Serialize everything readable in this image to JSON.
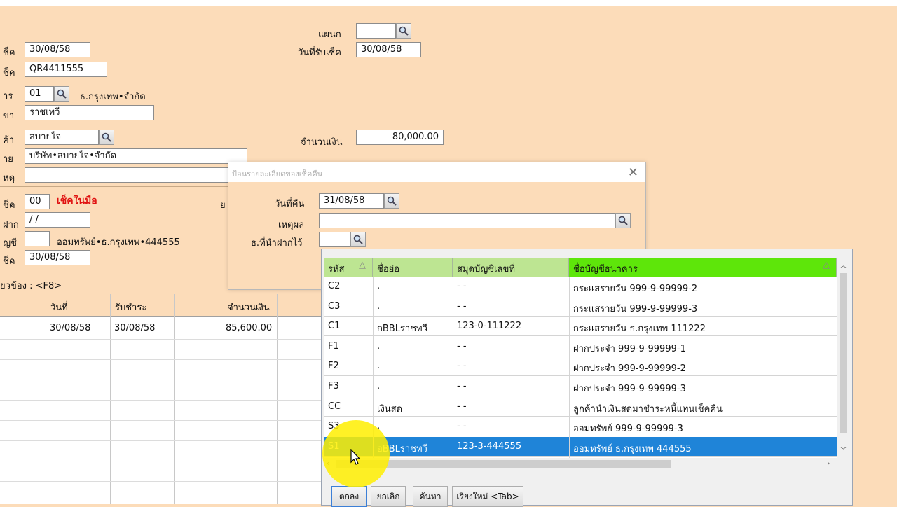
{
  "form": {
    "f_dept_label": "แผนก",
    "f_dept_value": "",
    "f_cheque_date_label": "ช็ค",
    "f_cheque_date_value": "30/08/58",
    "f_receive_date_label": "วันที่รับเช็ค",
    "f_receive_date_value": "30/08/58",
    "f_cheque_no_label": "ช็ค",
    "f_cheque_no_value": "QR4411555",
    "f_bank_label": "าร",
    "f_bank_code": "01",
    "f_bank_name": "ธ.กรุงเทพ•จำกัด",
    "f_branch_label": "ขา",
    "f_branch_value": "ราชเทวี",
    "f_customer_label": "ค้า",
    "f_customer_value": "สบายใจ",
    "f_amount_label": "จำนวนเงิน",
    "f_amount_value": "80,000.00",
    "f_payer_label": "าย",
    "f_payer_value": "บริษัท•สบายใจ•จำกัด",
    "f_note_label": "หตุ",
    "f_note_value": "",
    "f_status_label": "ช็ค",
    "f_status_code": "00",
    "f_status_text": "เช็คในมือ",
    "f_partial_label": "ย",
    "f_deposit_date_label": "ฝาก",
    "f_deposit_date_value": " / /",
    "f_account_label": "ญชี",
    "f_account_value": "",
    "f_account_name": "ออมทรัพย์•ธ.กรุงเทพ•444555",
    "f_clear_label": "ช็ค",
    "f_clear_value": "30/08/58",
    "f_related_label": "ยวข้อง :  <F8>"
  },
  "bg_table": {
    "headers": [
      "วันที่",
      "รับชำระ",
      "จำนวนเงิน"
    ],
    "rows": [
      [
        "30/08/58",
        "30/08/58",
        "85,600.00"
      ]
    ]
  },
  "dialog": {
    "title": "ป้อนรายละเอียดของเช็คคืน",
    "return_date_label": "วันที่คืน",
    "return_date_value": "31/08/58",
    "reason_label": "เหตุผล",
    "reason_value": "",
    "deposit_bank_label": "ธ.ที่นำฝากไว้",
    "deposit_bank_value": ""
  },
  "lookup": {
    "columns": [
      "รหัส",
      "ชื่อย่อ",
      "สมุดบัญชีเลขที่",
      "ชื่อบัญชีธนาคาร"
    ],
    "rows": [
      {
        "code": "C2",
        "short": ".",
        "book": "- -",
        "name": "กระแสรายวัน 999-9-99999-2"
      },
      {
        "code": "C3",
        "short": ".",
        "book": "- -",
        "name": "กระแสรายวัน 999-9-99999-3"
      },
      {
        "code": "C1",
        "short": "กBBLราชทวี",
        "book": "123-0-111222",
        "name": "กระแสรายวัน ธ.กรุงเทพ 111222"
      },
      {
        "code": "F1",
        "short": ".",
        "book": "- -",
        "name": "ฝากประจำ 999-9-99999-1"
      },
      {
        "code": "F2",
        "short": ".",
        "book": "- -",
        "name": "ฝากประจำ 999-9-99999-2"
      },
      {
        "code": "F3",
        "short": ".",
        "book": "- -",
        "name": "ฝากประจำ 999-9-99999-3"
      },
      {
        "code": "CC",
        "short": "เงินสด",
        "book": "- -",
        "name": "ลูกค้านำเงินสดมาชำระหนี้แทนเช็คคืน"
      },
      {
        "code": "S3",
        "short": ".",
        "book": "- -",
        "name": "ออมทรัพย์ 999-9-99999-3"
      },
      {
        "code": "S1",
        "short": "อBBLราชทวี",
        "book": "123-3-444555",
        "name": "ออมทรัพย์ ธ.กรุงเทพ 444555"
      }
    ],
    "selected_index": 8,
    "buttons": {
      "ok": "ตกลง",
      "cancel": "ยกเลิก",
      "search": "ค้นหา",
      "sort": "เรียงใหม่ <Tab>"
    }
  },
  "colors": {
    "background": "#fcdcb9",
    "selection": "#1f84d8",
    "header": "#bde592",
    "header_active": "#5ee60a",
    "status_red": "#e01010",
    "highlight": "#ffee00"
  },
  "icons": [
    "search-icon",
    "close-icon",
    "sort-asc-icon",
    "mouse-cursor-icon"
  ]
}
